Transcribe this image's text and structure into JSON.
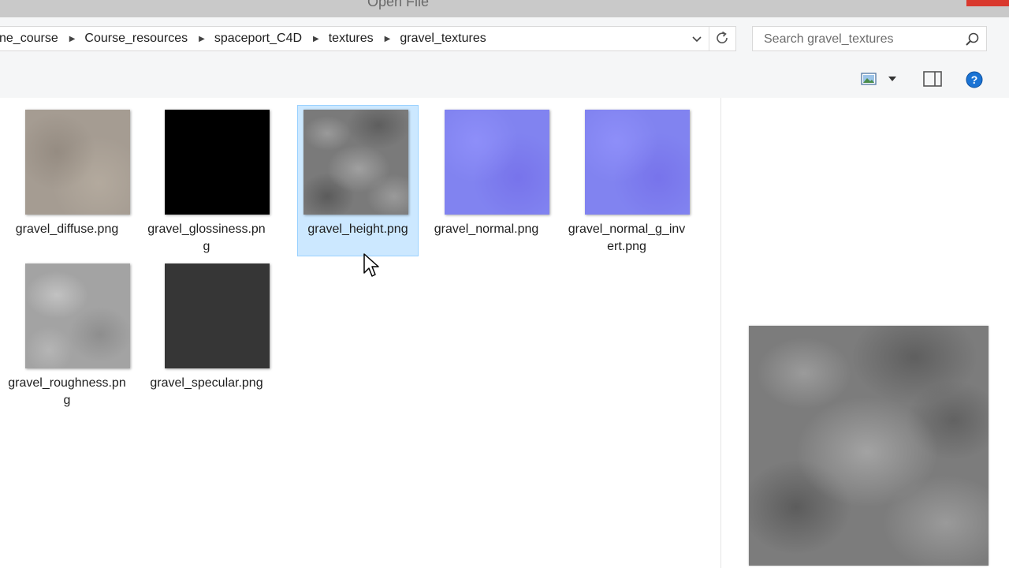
{
  "window": {
    "title": "Open File"
  },
  "address": {
    "crumbs": [
      "ne_course",
      "Course_resources",
      "spaceport_C4D",
      "textures",
      "gravel_textures"
    ]
  },
  "search": {
    "placeholder": "Search gravel_textures"
  },
  "toolbar": {
    "icons": [
      "change-view-icon",
      "view-options-chevron-icon",
      "preview-pane-icon",
      "help-icon"
    ],
    "help_color": "#1a73d4"
  },
  "files": [
    {
      "name": "gravel_diffuse.png",
      "thumb_color": "#a59c92",
      "selected": false
    },
    {
      "name": "gravel_glossiness.png",
      "thumb_color": "#000000",
      "selected": false
    },
    {
      "name": "gravel_height.png",
      "thumb_color": "#7a7a7a",
      "selected": true
    },
    {
      "name": "gravel_normal.png",
      "thumb_color": "#8183f0",
      "selected": false
    },
    {
      "name": "gravel_normal_g_invert.png",
      "thumb_color": "#8183f0",
      "selected": false
    },
    {
      "name": "gravel_roughness.png",
      "thumb_color": "#a3a3a3",
      "selected": false
    },
    {
      "name": "gravel_specular.png",
      "thumb_color": "#363636",
      "selected": false
    }
  ],
  "preview": {
    "file": "gravel_height.png"
  },
  "colors": {
    "selection_bg": "#cce8ff",
    "selection_border": "#99d1ff",
    "close_button": "#d9382d"
  }
}
